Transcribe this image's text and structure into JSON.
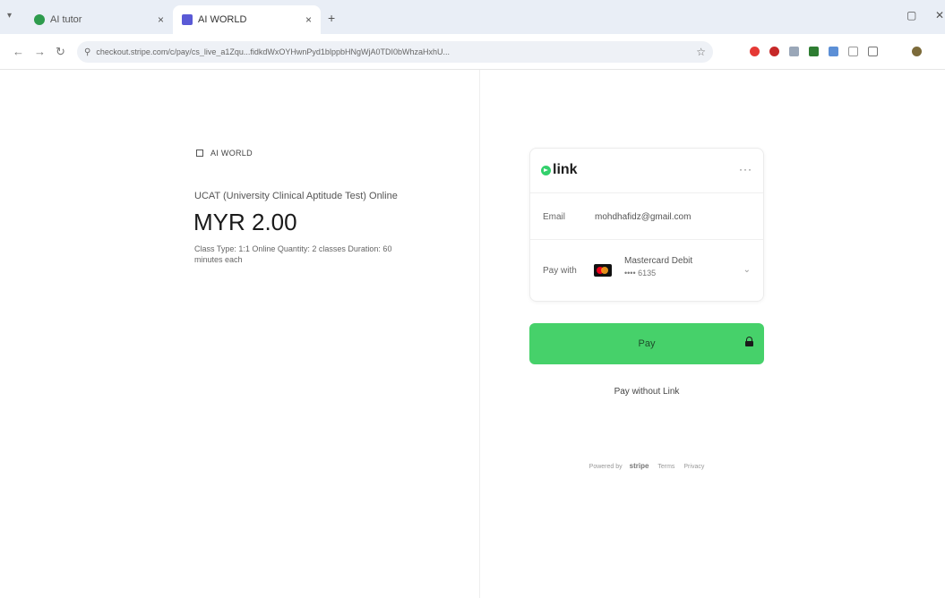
{
  "browser": {
    "tabs": [
      {
        "title": "AI tutor",
        "active": false
      },
      {
        "title": "AI WORLD",
        "active": true
      }
    ],
    "new_tab": "+",
    "close": "×",
    "url": "checkout.stripe.com/c/pay/cs_live_a1Zqu...fidkdWxOYHwnPyd1blppbHNgWjA0TDI0bWhzaHxhU...",
    "win_min": "▢",
    "win_close": "✕"
  },
  "merchant": {
    "name": "AI WORLD",
    "product": "UCAT (University Clinical Aptitude Test) Online",
    "price": "MYR 2.00",
    "description": "Class Type: 1:1 Online Quantity: 2 classes Duration: 60 minutes each"
  },
  "link": {
    "brand": "link",
    "more": "···",
    "email_label": "Email",
    "email_value": "mohdhafidz@gmail.com",
    "pay_with_label": "Pay with",
    "card_name": "Mastercard Debit",
    "card_number": "•••• 6135"
  },
  "actions": {
    "pay_label": "Pay",
    "pay_without_link": "Pay without Link"
  },
  "footer": {
    "powered_by": "Powered by",
    "stripe": "stripe",
    "terms": "Terms",
    "privacy": "Privacy"
  },
  "colors": {
    "pay_button": "#46d16a",
    "link_dot": "#33d06c"
  }
}
